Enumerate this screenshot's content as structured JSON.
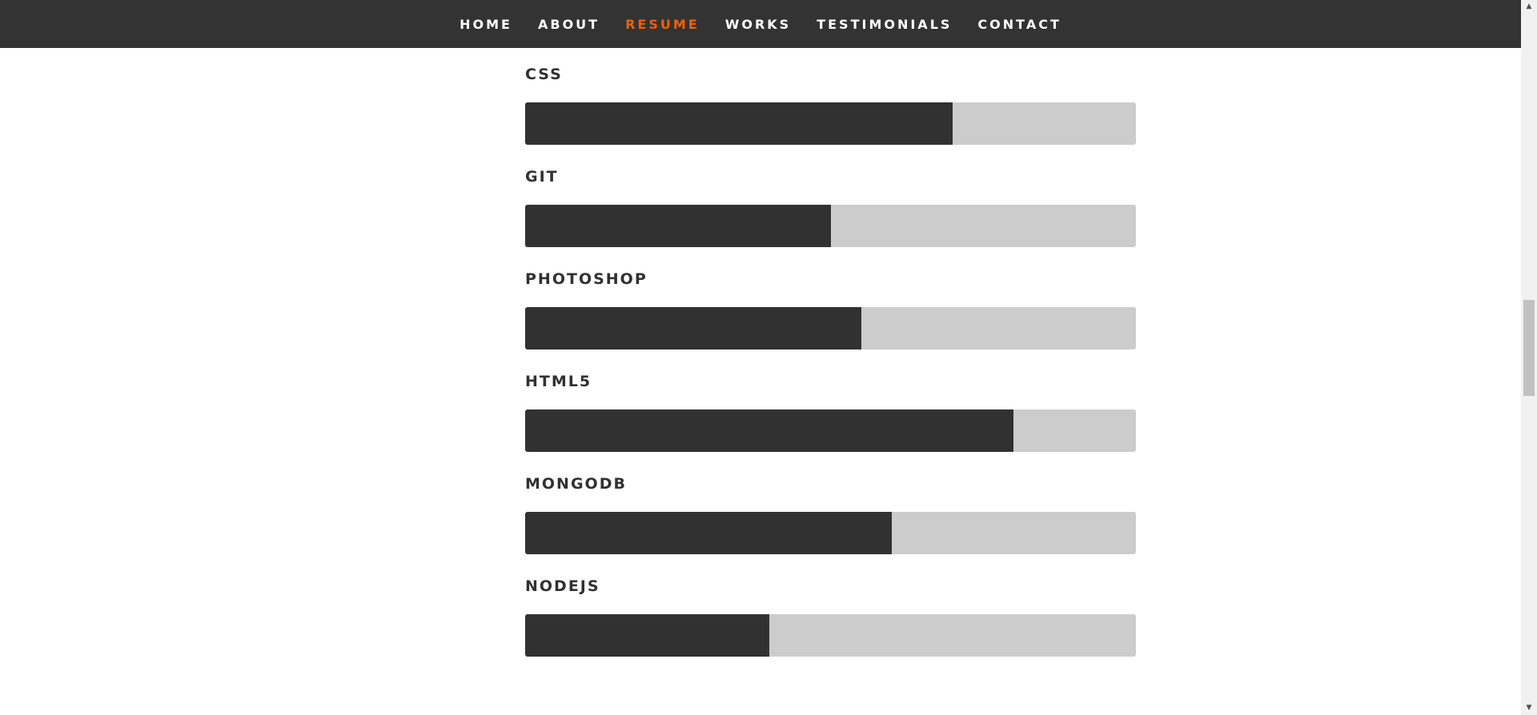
{
  "nav": {
    "items": [
      {
        "label": "HOME"
      },
      {
        "label": "ABOUT"
      },
      {
        "label": "RESUME"
      },
      {
        "label": "WORKS"
      },
      {
        "label": "TESTIMONIALS"
      },
      {
        "label": "CONTACT"
      }
    ],
    "active_item": "RESUME",
    "active_color": "#F06000",
    "background_color": "#333333"
  },
  "skills": [
    {
      "name": "CSS",
      "level_percent": 70
    },
    {
      "name": "GIT",
      "level_percent": 50
    },
    {
      "name": "PHOTOSHOP",
      "level_percent": 55
    },
    {
      "name": "HTML5",
      "level_percent": 80
    },
    {
      "name": "MONGODB",
      "level_percent": 60
    },
    {
      "name": "NODEJS",
      "level_percent": 40
    }
  ],
  "colors": {
    "bar_fill": "#313131",
    "bar_track": "#cccccc"
  },
  "scrollbar": {
    "up_icon": "scroll-up-arrow-icon",
    "down_icon": "scroll-down-arrow-icon"
  }
}
